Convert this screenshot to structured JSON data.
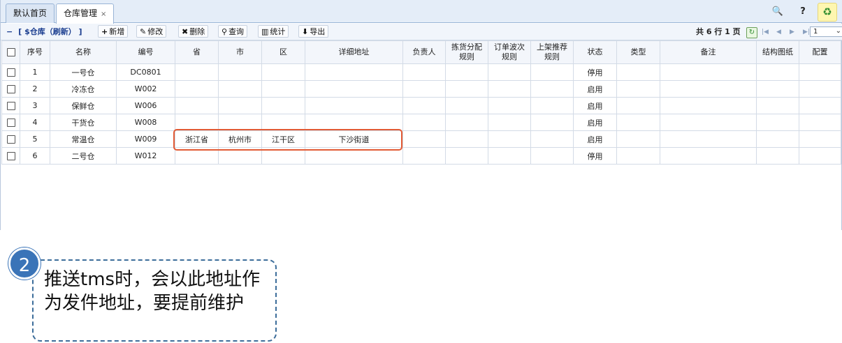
{
  "tabs": [
    {
      "label": "默认首页",
      "active": false
    },
    {
      "label": "仓库管理",
      "active": true,
      "close": "×"
    }
  ],
  "tools": [
    {
      "name": "search-icon",
      "glyph": "🔍"
    },
    {
      "name": "help-icon",
      "glyph": "?"
    },
    {
      "name": "refresh-icon",
      "glyph": "♻"
    }
  ],
  "toolbar": {
    "collapse": "−",
    "title": "[ $仓库（刷新） ]",
    "buttons": [
      {
        "name": "add",
        "icon": "+",
        "label": "新增"
      },
      {
        "name": "edit",
        "icon": "✎",
        "label": "修改"
      },
      {
        "name": "delete",
        "icon": "✖",
        "label": "删除"
      },
      {
        "name": "query",
        "icon": "⚲",
        "label": "查询"
      },
      {
        "name": "stats",
        "icon": "▥",
        "label": "统计"
      },
      {
        "name": "export",
        "icon": "⬇",
        "label": "导出"
      }
    ]
  },
  "pager": {
    "summary": "共 6 行 1 页",
    "page": "1"
  },
  "table": {
    "headers": [
      "序号",
      "名称",
      "编号",
      "省",
      "市",
      "区",
      "详细地址",
      "负责人",
      "拣货分配\n规则",
      "订单波次\n规则",
      "上架推荐\n规则",
      "状态",
      "类型",
      "备注",
      "结构图纸",
      "配置"
    ],
    "rows": [
      {
        "no": "1",
        "name": "一号仓",
        "code": "DC0801",
        "province": "",
        "city": "",
        "district": "",
        "address": "",
        "status": "停用",
        "enabled": false
      },
      {
        "no": "2",
        "name": "冷冻仓",
        "code": "W002",
        "province": "",
        "city": "",
        "district": "",
        "address": "",
        "status": "启用",
        "enabled": true
      },
      {
        "no": "3",
        "name": "保鲜仓",
        "code": "W006",
        "province": "",
        "city": "",
        "district": "",
        "address": "",
        "status": "启用",
        "enabled": true
      },
      {
        "no": "4",
        "name": "干货仓",
        "code": "W008",
        "province": "",
        "city": "",
        "district": "",
        "address": "",
        "status": "启用",
        "enabled": true
      },
      {
        "no": "5",
        "name": "常温仓",
        "code": "W009",
        "province": "浙江省",
        "city": "杭州市",
        "district": "江干区",
        "address": "下沙街道",
        "status": "启用",
        "enabled": true
      },
      {
        "no": "6",
        "name": "二号仓",
        "code": "W012",
        "province": "",
        "city": "",
        "district": "",
        "address": "",
        "status": "停用",
        "enabled": false
      }
    ]
  },
  "annotation": {
    "step": "2",
    "text": "推送tms时，会以此地址作为发件地址，要提前维护"
  },
  "colors": {
    "accent": "#3a74b8",
    "highlight": "#e25a34",
    "disabled": "#b0b0b0"
  }
}
